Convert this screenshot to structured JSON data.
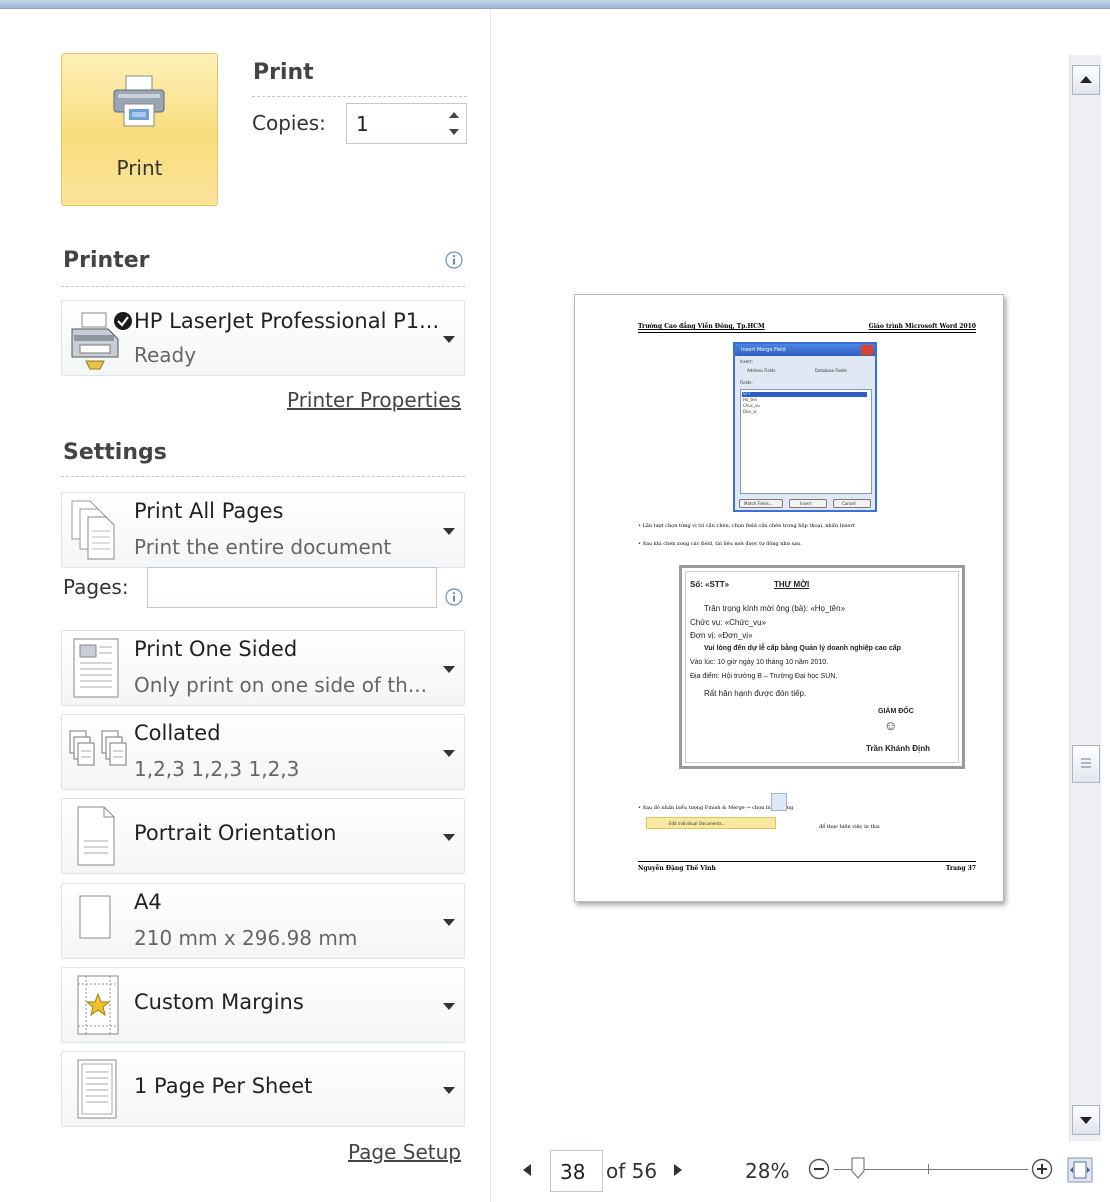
{
  "print": {
    "section_title": "Print",
    "button_label": "Print",
    "copies_label": "Copies:",
    "copies_value": "1"
  },
  "printer": {
    "section_title": "Printer",
    "name": "HP LaserJet Professional P1...",
    "status": "Ready",
    "properties_link": "Printer Properties"
  },
  "settings": {
    "section_title": "Settings",
    "print_range": {
      "title": "Print All Pages",
      "subtitle": "Print the entire document"
    },
    "pages_label": "Pages:",
    "pages_value": "",
    "sides": {
      "title": "Print One Sided",
      "subtitle": "Only print on one side of th..."
    },
    "collation": {
      "title": "Collated",
      "subtitle": "1,2,3   1,2,3   1,2,3"
    },
    "orientation": {
      "title": "Portrait Orientation"
    },
    "paper": {
      "title": "A4",
      "subtitle": "210 mm x 296.98 mm"
    },
    "margins": {
      "title": "Custom Margins"
    },
    "pages_per_sheet": {
      "title": "1 Page Per Sheet"
    },
    "page_setup_link": "Page Setup"
  },
  "preview": {
    "doc": {
      "header_left": "Trường Cao đẳng Viễn Đông, Tp.HCM",
      "header_right": "Giáo trình Microsoft Word 2010",
      "dialog_title": "Insert Merge Field",
      "dialog_insert": "Insert:",
      "dialog_address": "Address Fields",
      "dialog_database": "Database Fields",
      "dialog_fields": "Fields:",
      "dialog_items": [
        "STT",
        "Ho_ten",
        "Chuc_vu",
        "Don_vi"
      ],
      "dialog_btn_match": "Match Fields...",
      "dialog_btn_insert": "Insert",
      "dialog_btn_cancel": "Cancel",
      "bullet1": "• Lần lượt chọn từng vị trí cần chèn, chọn field cần chèn trong hộp thoại, nhấn Insert",
      "bullet2": "• Sau khi chèn xong các field, tài liệu mới được tự động như sau.",
      "inv_so": "Số: «STT»",
      "inv_title": "THƯ MỜI",
      "inv_line1": "Trân trọng kính mời ông (bà): «Họ_tên»",
      "inv_line2": "Chức vụ: «Chức_vụ»",
      "inv_line3": "Đơn vị: «Đơn_vị»",
      "inv_line4": "Vui lòng đến dự lễ cấp bằng Quản lý doanh nghiệp cao cấp",
      "inv_line5": "Vào lúc: 10 giờ ngày 10 tháng 10 năm 2010.",
      "inv_line6": "Địa điểm: Hội trường B – Trường Đại học SUN.",
      "inv_line7": "Rất hân hạnh được đón tiếp.",
      "inv_sign_title": "GIÁM ĐỐC",
      "inv_smiley": "☺",
      "inv_sign_name": "Trần Khánh Định",
      "bullet3": "• Sau đó nhấn biểu tượng     Finish & Merge → chọn biểu tượng",
      "edit_docs": "Edit Individual Documents...",
      "bullet3b": "để thực hiện việc in thư.",
      "footer_left": "Nguyễn Đặng Thế Vinh",
      "footer_right": "Trang 37"
    },
    "page_number": "38",
    "page_total": "of 56",
    "zoom": "28%"
  },
  "colors": {
    "print_button": "#f9dc7c",
    "accent_blue": "#2b5797",
    "dropdown_border": "#dfe3e8"
  },
  "icons": [
    "printer-icon",
    "info-icon",
    "dropdown-arrow-icon",
    "pages-icon",
    "one-sided-icon",
    "collated-icon",
    "portrait-icon",
    "paper-icon",
    "custom-margins-icon",
    "page-per-sheet-icon",
    "zoom-out-icon",
    "zoom-in-icon",
    "fit-page-icon"
  ]
}
